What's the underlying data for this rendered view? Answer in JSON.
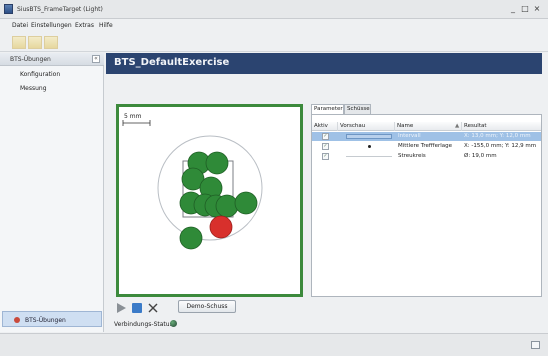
{
  "window": {
    "title": "SiusBTS_FrameTarget (Light)",
    "minimize": "_",
    "maximize": "□",
    "close": "×"
  },
  "menu": [
    "Datei",
    "Einstellungen",
    "Extras",
    "Hilfe"
  ],
  "sidebar": {
    "header": "BTS-Übungen",
    "collapse_glyph": "«",
    "items": [
      "Konfiguration",
      "Messung"
    ],
    "bottom_tab": "BTS-Übungen"
  },
  "exercise": {
    "title": "BTS_DefaultExercise"
  },
  "target": {
    "scale_label": "5 mm",
    "colors": {
      "hit": "#2f8a38",
      "last_hit": "#d8302c",
      "frame": "#3c8a3c"
    },
    "shots_count": 11,
    "last_shot_count": 1
  },
  "controls": {
    "play_icon": "play-icon",
    "stop_icon": "stop-icon",
    "clear_icon": "clear-icon",
    "demo_button": "Demo-Schuss",
    "status_label": "Verbindungs-Status:"
  },
  "results": {
    "tabs": [
      "Parameter",
      "Schüsse"
    ],
    "active_tab": "Parameter",
    "columns": [
      "Aktiv",
      "Vorschau",
      "Name",
      "Resultat"
    ],
    "sort_glyph": "▲",
    "rows": [
      {
        "active": true,
        "preview": "box",
        "name": "Intervall",
        "result": "X: 13,0 mm; Y: 12,0 mm",
        "selected": true
      },
      {
        "active": true,
        "preview": "dot",
        "name": "Mittlere Treffferlage",
        "result": "X: -155,0 mm; Y: 12,9 mm",
        "selected": false
      },
      {
        "active": true,
        "preview": "line",
        "name": "Streukreis",
        "result": "Ø: 19,0 mm",
        "selected": false
      }
    ]
  }
}
